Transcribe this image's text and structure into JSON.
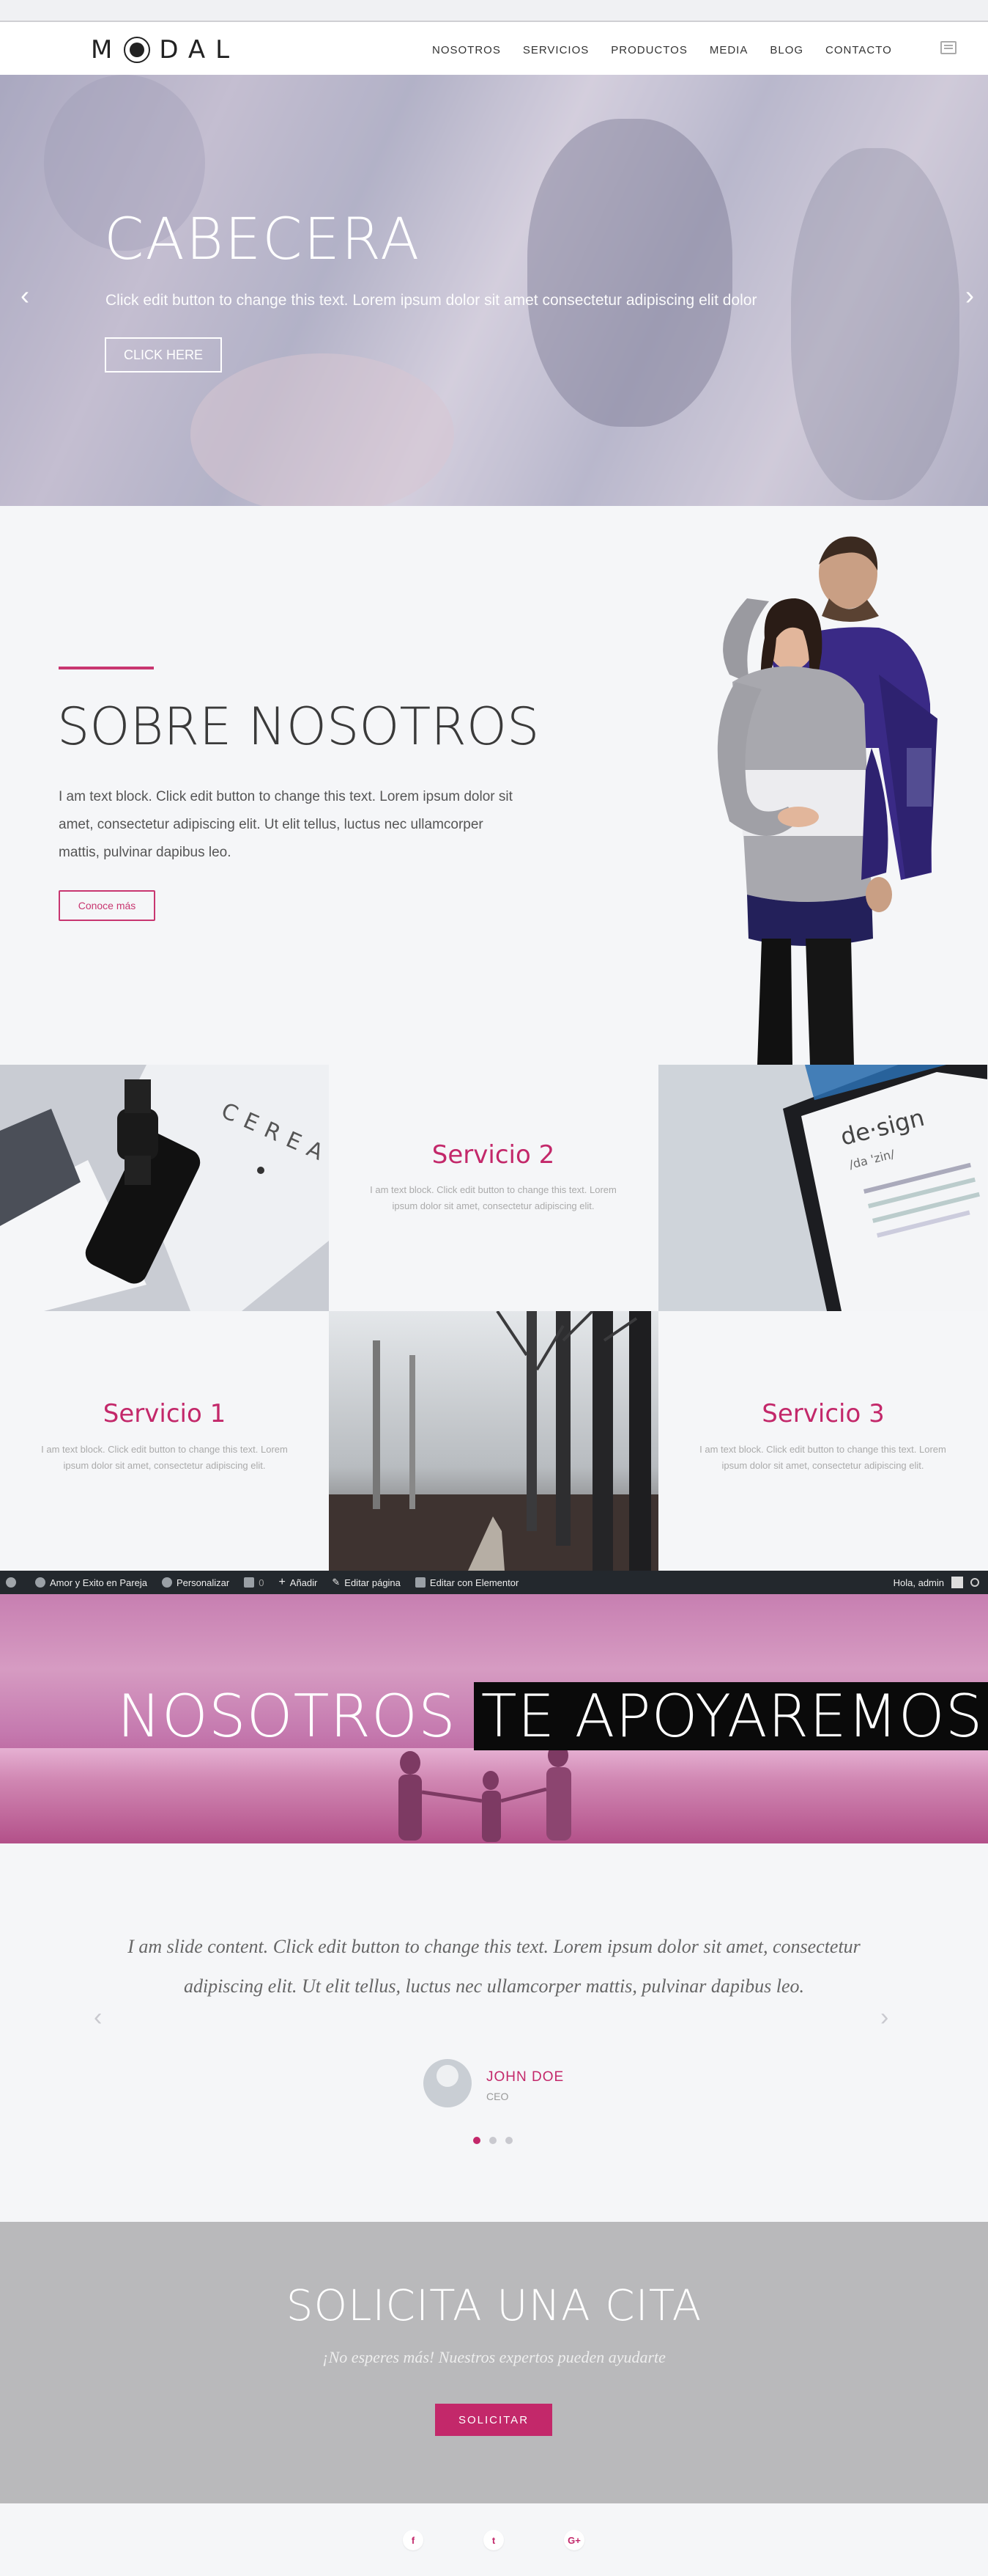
{
  "brand": {
    "logo": "MODAL",
    "accent": "#c3286a"
  },
  "nav": {
    "items": [
      "NOSOTROS",
      "SERVICIOS",
      "PRODUCTOS",
      "MEDIA",
      "BLOG",
      "CONTACTO"
    ]
  },
  "hero": {
    "title": "CABECERA",
    "text": "Click edit button to change this text. Lorem ipsum dolor sit amet consectetur adipiscing elit dolor",
    "button": "CLICK HERE"
  },
  "about": {
    "title": "SOBRE NOSOTROS",
    "text": "I am text block. Click edit button to change this text. Lorem ipsum dolor sit amet, consectetur adipiscing elit. Ut elit tellus, luctus nec ullamcorper mattis, pulvinar dapibus leo.",
    "button": "Conoce más"
  },
  "services": [
    {
      "title": "Servicio 1",
      "text": "I am text block. Click edit button to change this text. Lorem ipsum dolor sit amet, consectetur adipiscing elit."
    },
    {
      "title": "Servicio 2",
      "text": "I am text block. Click edit button to change this text. Lorem ipsum dolor sit amet, consectetur adipiscing elit."
    },
    {
      "title": "Servicio 3",
      "text": "I am text block. Click edit button to change this text. Lorem ipsum dolor sit amet, consectetur adipiscing elit."
    }
  ],
  "images": {
    "design_card": "de·sign",
    "design_phonetic": "/da 'zin/",
    "cereal_text": "CEREAL"
  },
  "admin_bar": {
    "site": "Amor y Exito en Pareja",
    "customize": "Personalizar",
    "comments": "0",
    "add": "Añadir",
    "edit_page": "Editar página",
    "edit_elementor": "Editar con Elementor",
    "greeting": "Hola, admin"
  },
  "banner": {
    "title_a": "NOSOTROS",
    "title_b": "TE APOYAREMOS"
  },
  "testimonial": {
    "quote": "I am slide content. Click edit button to change this text. Lorem ipsum dolor sit amet, consectetur adipiscing elit. Ut elit tellus, luctus nec ullamcorper mattis, pulvinar dapibus leo.",
    "name": "JOHN DOE",
    "role": "CEO",
    "active_slide": 1,
    "slide_count": 3
  },
  "cta": {
    "title": "SOLICITA UNA CITA",
    "subtitle": "¡No esperes más! Nuestros expertos pueden ayudarte",
    "button": "SOLICITAR"
  },
  "social": {
    "facebook": "f",
    "twitter": "t",
    "googleplus": "G+"
  }
}
